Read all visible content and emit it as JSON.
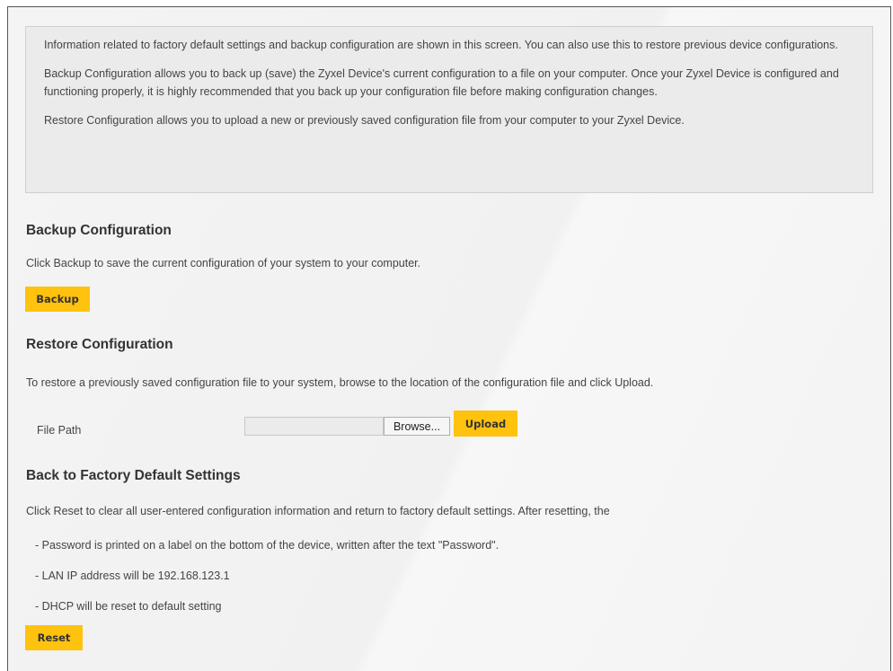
{
  "info": {
    "p1": "Information related to factory default settings and backup configuration are shown in this screen. You can also use this to restore previous device configurations.",
    "p2": "Backup Configuration allows you to back up (save) the Zyxel Device's current configuration to a file on your computer. Once your Zyxel Device is configured and functioning properly, it is highly recommended that you back up your configuration file before making configuration changes.",
    "p3": "Restore Configuration allows you to upload a new or previously saved configuration file from your computer to your Zyxel Device."
  },
  "backup": {
    "title": "Backup Configuration",
    "description": "Click Backup to save the current configuration of your system to your computer.",
    "button": "Backup"
  },
  "restore": {
    "title": "Restore Configuration",
    "description": "To restore a previously saved configuration file to your system, browse to the location of the configuration file and click Upload.",
    "file_path_label": "File Path",
    "file_path_value": "",
    "browse_button": "Browse...",
    "upload_button": "Upload"
  },
  "factory": {
    "title": "Back to Factory Default Settings",
    "description": "Click Reset to clear all user-entered configuration information and return to factory default settings. After resetting, the",
    "bullets": [
      "- Password is printed on a label on the bottom of the device, written after the text \"Password\".",
      "- LAN IP address will be 192.168.123.1",
      "- DHCP will be reset to default setting"
    ],
    "reset_button": "Reset"
  },
  "colors": {
    "accent": "#ffc20e",
    "panel_background": "#f3f3f3",
    "info_background": "#ebebeb"
  }
}
